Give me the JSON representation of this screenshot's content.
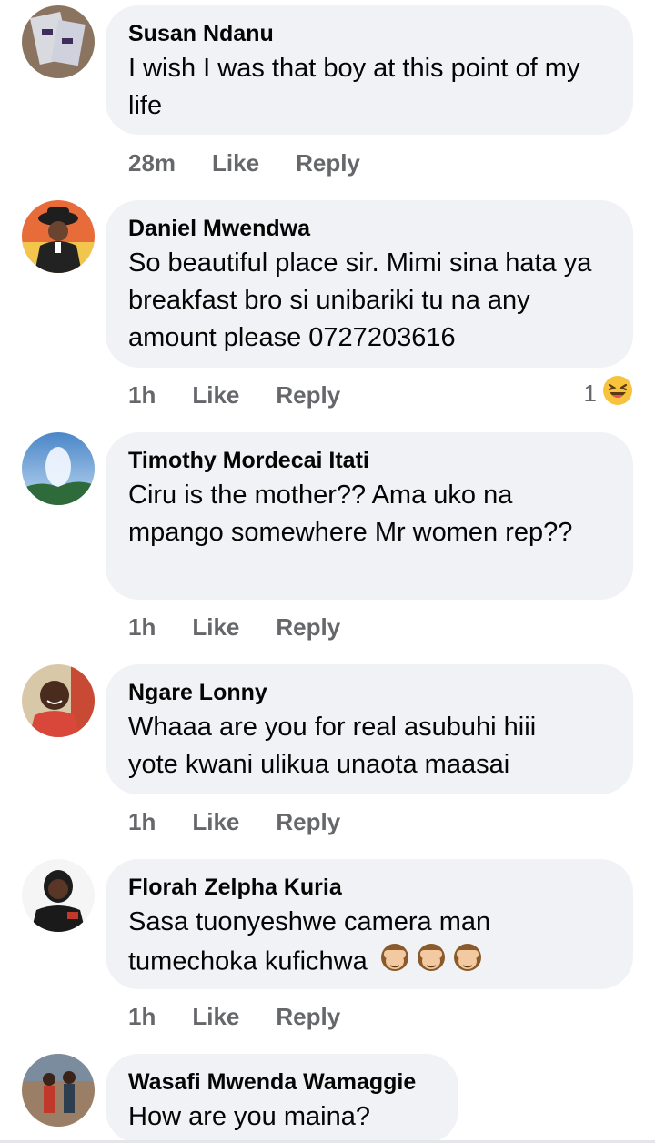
{
  "comments": [
    {
      "author": "Susan Ndanu",
      "text": "I wish I was that boy at this point of my life",
      "time": "28m",
      "like_label": "Like",
      "reply_label": "Reply"
    },
    {
      "author": "Daniel Mwendwa",
      "text": "So beautiful place sir. Mimi sina hata ya breakfast bro si unibariki tu na any amount please 0727203616",
      "time": "1h",
      "like_label": "Like",
      "reply_label": "Reply",
      "reaction_count": "1",
      "reaction_icon": "laughing-reaction-icon"
    },
    {
      "author": "Timothy Mordecai Itati",
      "text": "Ciru is the mother?? Ama uko na mpango somewhere Mr women rep??",
      "time": "1h",
      "like_label": "Like",
      "reply_label": "Reply"
    },
    {
      "author": "Ngare Lonny",
      "text": "Whaaa are you for real asubuhi hiii yote kwani ulikua unaota maasai",
      "time": "1h",
      "like_label": "Like",
      "reply_label": "Reply"
    },
    {
      "author": "Florah Zelpha Kuria",
      "text": "Sasa tuonyeshwe camera man tumechoka kufichwa",
      "emoji": "see-no-evil-monkey-icon",
      "time": "1h",
      "like_label": "Like",
      "reply_label": "Reply"
    },
    {
      "author": "Wasafi Mwenda Wamaggie",
      "text": "How are you maina?"
    }
  ]
}
